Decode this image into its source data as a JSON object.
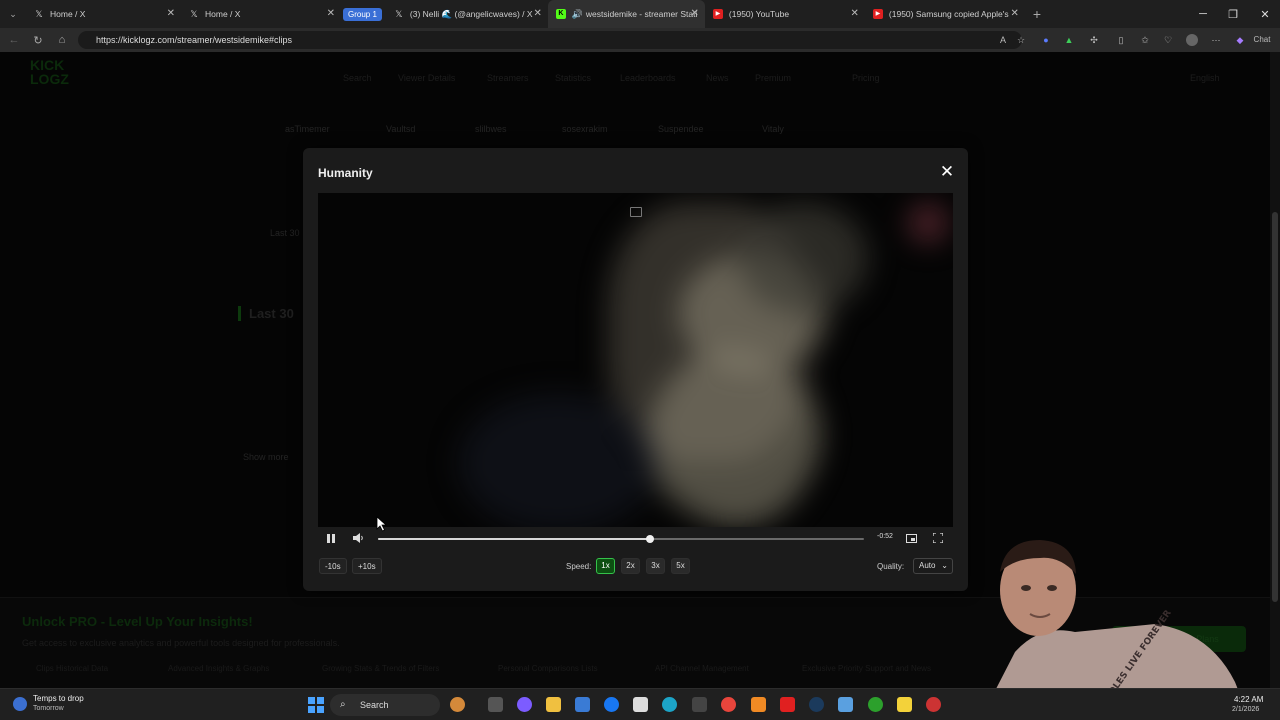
{
  "browser": {
    "tabs": [
      {
        "label": "Home / X",
        "icon": "x-logo-icon"
      },
      {
        "label": "Home / X",
        "icon": "x-logo-icon"
      },
      {
        "label": "(3) Nelli 🌊 (@angelicwaves) / X",
        "icon": "x-logo-icon"
      },
      {
        "label": "westsidemike - streamer Stati",
        "icon": "kick-logo-icon"
      },
      {
        "label": "(1950) YouTube",
        "icon": "youtube-icon"
      },
      {
        "label": "(1950) Samsung copied Apple's",
        "icon": "youtube-icon"
      }
    ],
    "group_label": "Group 1",
    "url": "https://kicklogz.com/streamer/westsidemike#clips",
    "chat_label": "Chat"
  },
  "site": {
    "logo": "KICK\nLOGZ",
    "nav": [
      "Search",
      "Viewer Details",
      "Streamers",
      "Statistics",
      "Leaderboards",
      "News",
      "Premium",
      "Pricing"
    ],
    "language": "English",
    "badges": [
      "asTimemer",
      "Vaultsd",
      "slilbwes",
      "sosexrakim",
      "Suspendee",
      "Vitaly"
    ],
    "section_titles": [
      "Last 30",
      "Last 30"
    ],
    "show_more": "Show more"
  },
  "promo": {
    "title": "Unlock PRO - Level Up Your Insights!",
    "description": "Get access to exclusive analytics and powerful tools designed for professionals.",
    "button": "See Pricing & Plans",
    "features": [
      "Clips Historical Data",
      "Advanced Insights & Graphs",
      "Growing Stats & Trends of Filters",
      "Personal Comparisons Lists",
      "API Channel Management",
      "Exclusive Priority Support and News"
    ]
  },
  "modal": {
    "title": "Humanity",
    "player": {
      "progress_fraction": 0.56,
      "time_remaining": "-0:52",
      "skip_back": "-10s",
      "skip_forward": "+10s",
      "speed_label": "Speed:",
      "speeds": [
        "1x",
        "2x",
        "3x",
        "5x"
      ],
      "selected_speed": "1x",
      "quality_label": "Quality:",
      "quality_value": "Auto"
    }
  },
  "taskbar": {
    "weather_title": "Temps to drop",
    "weather_sub": "Tomorrow",
    "search": "Search",
    "time": "4:22 AM",
    "date": "2/1/2026"
  },
  "webcam_caption": "ASSHOLES LIVE FOREVER"
}
